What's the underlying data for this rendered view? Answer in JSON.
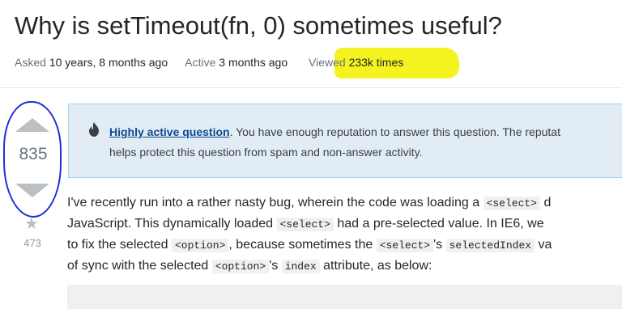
{
  "question": {
    "title": "Why is setTimeout(fn, 0) sometimes useful?",
    "meta": {
      "asked_label": "Asked",
      "asked_value": "10 years, 8 months ago",
      "active_label": "Active",
      "active_value": "3 months ago",
      "viewed_label": "Viewed",
      "viewed_value": "233k times"
    },
    "votes": "835",
    "favorites": "473",
    "notice": {
      "link": "Highly active question",
      "line1_rest": ". You have enough reputation to answer this question. The reputat",
      "line2": "helps protect this question from spam and non-answer activity."
    },
    "body": {
      "l1a": "I've recently run into a rather nasty bug, wherein the code was loading a ",
      "l1code": "<select>",
      "l1b": " d",
      "l2a": "JavaScript. This dynamically loaded ",
      "l2code": "<select>",
      "l2b": " had a pre-selected value. In IE6, we",
      "l3a": "to fix the selected ",
      "l3code1": "<option>",
      "l3b": ", because sometimes the ",
      "l3code2": "<select>",
      "l3c": "'s ",
      "l3code3": "selectedIndex",
      "l3d": " va",
      "l4a": "of sync with the selected ",
      "l4code1": "<option>",
      "l4b": "'s ",
      "l4code2": "index",
      "l4c": " attribute, as below:"
    }
  },
  "colors": {
    "highlight": "#f4f320",
    "annotation_circle": "#1c2fd6",
    "notice_bg": "#e1ecf4"
  }
}
